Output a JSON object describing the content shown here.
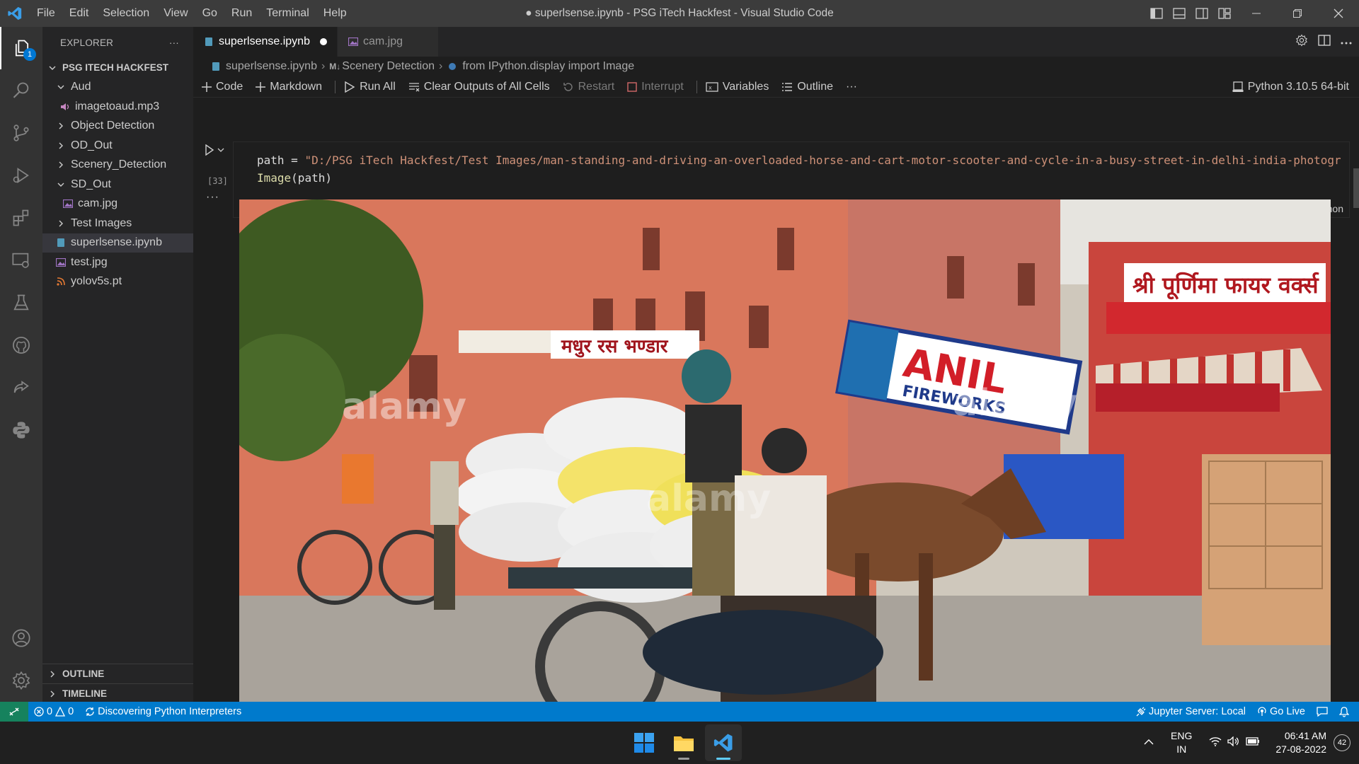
{
  "titlebar": {
    "menu": [
      "File",
      "Edit",
      "Selection",
      "View",
      "Go",
      "Run",
      "Terminal",
      "Help"
    ],
    "title": "● superlsense.ipynb - PSG iTech Hackfest - Visual Studio Code"
  },
  "activity": {
    "explorer_badge": "1"
  },
  "sidebar": {
    "header": "EXPLORER",
    "more": "···",
    "root": "PSG ITECH HACKFEST",
    "items": [
      {
        "label": "Aud"
      },
      {
        "label": "imagetoaud.mp3"
      },
      {
        "label": "Object Detection"
      },
      {
        "label": "OD_Out"
      },
      {
        "label": "Scenery_Detection"
      },
      {
        "label": "SD_Out"
      },
      {
        "label": "cam.jpg"
      },
      {
        "label": "Test Images"
      },
      {
        "label": "superlsense.ipynb"
      },
      {
        "label": "test.jpg"
      },
      {
        "label": "yolov5s.pt"
      }
    ],
    "outline": "OUTLINE",
    "timeline": "TIMELINE"
  },
  "tabs": [
    {
      "label": "superlsense.ipynb",
      "modified": true
    },
    {
      "label": "cam.jpg"
    }
  ],
  "breadcrumb": {
    "file": "superlsense.ipynb",
    "md_tag": "M↓",
    "section": "Scenery Detection",
    "symbol": "from IPython.display import Image"
  },
  "toolbar": {
    "code": "Code",
    "markdown": "Markdown",
    "run_all": "Run All",
    "clear_outputs": "Clear Outputs of All Cells",
    "restart": "Restart",
    "interrupt": "Interrupt",
    "variables": "Variables",
    "outline": "Outline",
    "more": "···",
    "kernel": "Python 3.10.5 64-bit"
  },
  "cell": {
    "line1_var": "path",
    "line1_op": " = ",
    "line1_str": "\"D:/PSG iTech Hackfest/Test Images/man-standing-and-driving-an-overloaded-horse-and-cart-motor-scooter-and-cycle-in-a-busy-street-in-delhi-india-photogr",
    "line2_fn": "Image",
    "line2_arg": "(path)",
    "exec_count": "[33]",
    "language": "Python",
    "output_more": "···"
  },
  "image_text": {
    "sign_right": "श्री पूर्णिमा फायर वर्क्स",
    "sign_left": "मधुर रस भण्डार",
    "banner": "ANIL",
    "banner_sub": "FIREWORKS",
    "watermark": "alamy"
  },
  "statusbar": {
    "errors": "0",
    "warnings": "0",
    "discovering": "Discovering Python Interpreters",
    "jupyter": "Jupyter Server: Local",
    "golive": "Go Live"
  },
  "taskbar": {
    "lang1": "ENG",
    "lang2": "IN",
    "time": "06:41 AM",
    "date": "27-08-2022",
    "notifications": "42"
  },
  "colors": {
    "statusbar": "#007acc",
    "activity_bg": "#333333",
    "sidebar_bg": "#252526",
    "editor_bg": "#1e1e1e",
    "string": "#ce9178"
  }
}
